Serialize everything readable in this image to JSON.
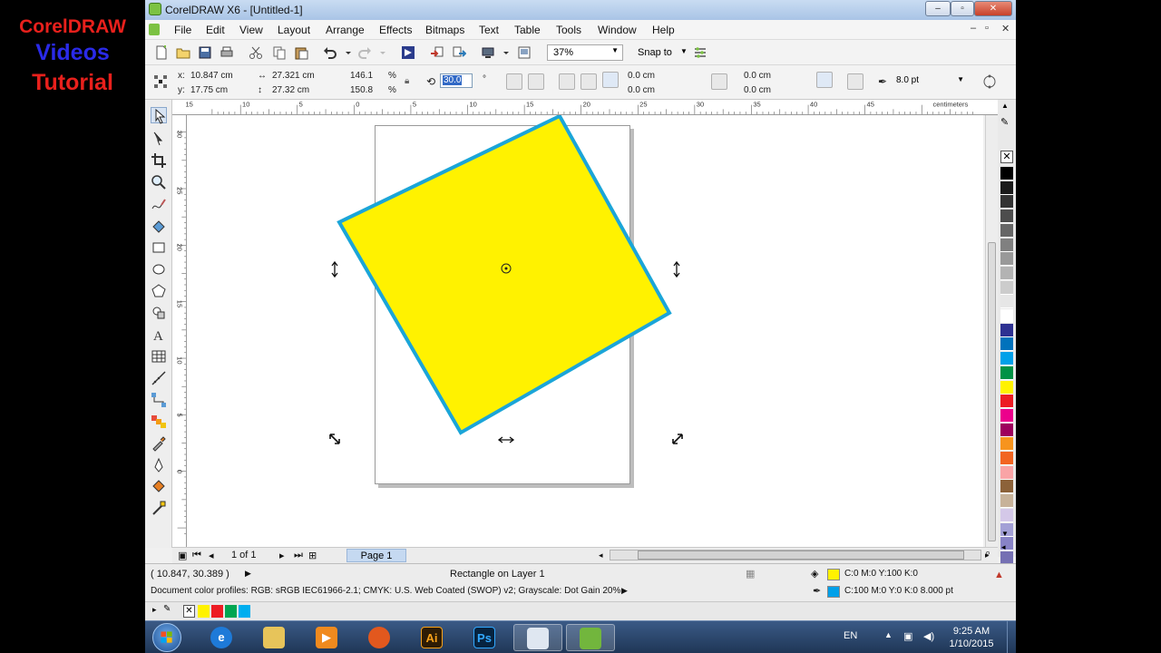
{
  "watermark": {
    "line1": "CorelDRAW",
    "line2": "Videos",
    "line3": "Tutorial"
  },
  "window": {
    "title": "CorelDRAW X6 - [Untitled-1]",
    "minimize": "–",
    "maximize": "▫",
    "close": "✕"
  },
  "menu": [
    "File",
    "Edit",
    "View",
    "Layout",
    "Arrange",
    "Effects",
    "Bitmaps",
    "Text",
    "Table",
    "Tools",
    "Window",
    "Help"
  ],
  "menu_controls": {
    "minimize": "–",
    "restore": "▫",
    "close": "✕"
  },
  "toolbar": {
    "zoom": "37%",
    "snap_to": "Snap to"
  },
  "property_bar": {
    "x_label": "x:",
    "x_value": "10.847 cm",
    "y_label": "y:",
    "y_value": "17.75 cm",
    "width": "27.321 cm",
    "height": "27.32 cm",
    "scale_x": "146.1",
    "scale_y": "150.8",
    "pct1": "%",
    "pct2": "%",
    "angle": "30.0",
    "degree": "°",
    "corner1": "0.0 cm",
    "corner2": "0.0 cm",
    "corner3": "0.0 cm",
    "corner4": "0.0 cm",
    "outline": "8.0 pt"
  },
  "ruler": {
    "h_ticks": [
      "15",
      "10",
      "5",
      "0",
      "5",
      "10",
      "15",
      "20",
      "25",
      "30",
      "35",
      "40",
      "45"
    ],
    "h_unit": "centimeters",
    "v_ticks": [
      "30",
      "25",
      "20",
      "15",
      "10",
      "5",
      "0"
    ],
    "v_unit": "centimeters"
  },
  "shape": {
    "fill": "#FFF200",
    "outline": "#1BA5D8"
  },
  "pages": {
    "counter": "1 of 1",
    "tab": "Page 1"
  },
  "status": {
    "coords": "( 10.847, 30.389 )",
    "object": "Rectangle on Layer 1",
    "profiles": "Document color profiles: RGB: sRGB IEC61966-2.1; CMYK: U.S. Web Coated (SWOP) v2; Grayscale: Dot Gain 20%",
    "fill_label": "C:0 M:0 Y:100 K:0",
    "outline_label": "C:100 M:0 Y:0 K:0  8.000 pt",
    "fill_color": "#FFF200",
    "outline_color": "#00A0E9"
  },
  "palette_colors": [
    "#000000",
    "#1a1a1a",
    "#333333",
    "#4d4d4d",
    "#666666",
    "#808080",
    "#999999",
    "#b3b3b3",
    "#cccccc",
    "#e6e6e6",
    "#ffffff",
    "#2e3192",
    "#0072bc",
    "#00a0e9",
    "#009245",
    "#fff200",
    "#ed1c24",
    "#ec008c",
    "#9e005d",
    "#f7941d",
    "#f26522",
    "#f9a4a6",
    "#8c6239",
    "#c7b299",
    "#d4c8e8",
    "#a3a0d6",
    "#8883c6",
    "#7570b3"
  ],
  "doc_palette": [
    "#FFF200",
    "#ED1C24",
    "#00A651",
    "#00AEEF"
  ],
  "taskbar": {
    "lang": "EN",
    "time": "9:25 AM",
    "date": "1/10/2015",
    "ai_label": "Ai",
    "ps_label": "Ps"
  }
}
